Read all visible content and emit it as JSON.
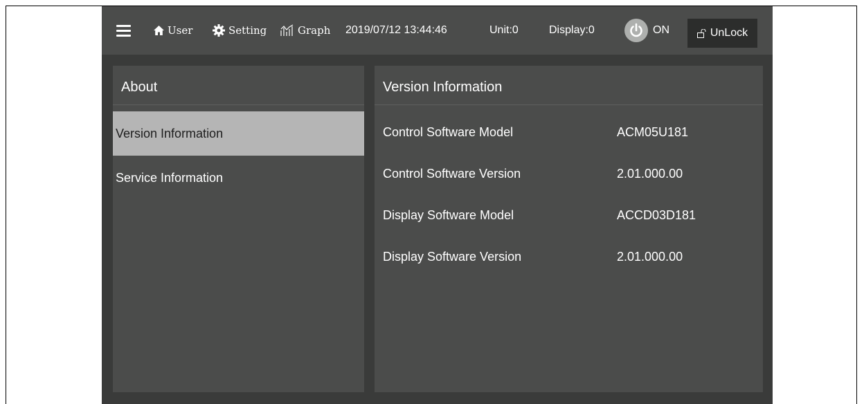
{
  "topbar": {
    "menu_icon": "hamburger-menu-icon",
    "user": {
      "icon": "home-icon",
      "label": "User"
    },
    "setting": {
      "icon": "gear-icon",
      "label": "Setting"
    },
    "graph": {
      "icon": "graph-icon",
      "label": "Graph"
    },
    "datetime": "2019/07/12 13:44:46",
    "unit": "Unit:0",
    "display": "Display:0",
    "power": {
      "icon": "power-icon",
      "label": "ON"
    },
    "lock": {
      "icon": "unlock-icon",
      "label": "UnLock"
    }
  },
  "sidebar": {
    "title": "About",
    "items": [
      {
        "label": "Version Information",
        "active": true
      },
      {
        "label": "Service Information",
        "active": false
      }
    ]
  },
  "main": {
    "title": "Version Information",
    "rows": [
      {
        "label": "Control Software Model",
        "value": "ACM05U181"
      },
      {
        "label": "Control Software Version",
        "value": "2.01.000.00"
      },
      {
        "label": "Display Software Model",
        "value": "ACCD03D181"
      },
      {
        "label": "Display Software Version",
        "value": "2.01.000.00"
      }
    ]
  },
  "colors": {
    "background": "#3a3b3a",
    "panel": "#4b4c4b",
    "active_item": "#b5b5b5",
    "text": "#ffffff"
  }
}
